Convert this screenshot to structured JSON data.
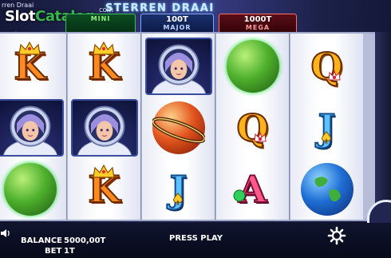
{
  "header": {
    "game_title_small": "rren Draai",
    "watermark_main": "Slot",
    "watermark_accent": "Catalog",
    "watermark_suffix": "com",
    "logo": "STERREN DRAAI"
  },
  "jackpots": [
    {
      "name": "MINI",
      "amount": ""
    },
    {
      "name": "MAJOR",
      "amount": "100T"
    },
    {
      "name": "MEGA",
      "amount": "1000T"
    }
  ],
  "reels": [
    [
      "K",
      "astronaut",
      "green-planet"
    ],
    [
      "K",
      "astronaut",
      "K"
    ],
    [
      "astronaut",
      "red-planet",
      "J"
    ],
    [
      "green-planet",
      "Q",
      "A"
    ],
    [
      "Q",
      "J",
      "earth-planet"
    ]
  ],
  "bottom": {
    "balance_label": "BALANCE",
    "balance_value": "5000,00T",
    "bet_label": "BET",
    "bet_value": "1T",
    "press_play": "PRESS PLAY"
  },
  "colors": {
    "mini": "#3fb65f",
    "major": "#7fa7ff",
    "mega": "#ff6d6d"
  }
}
